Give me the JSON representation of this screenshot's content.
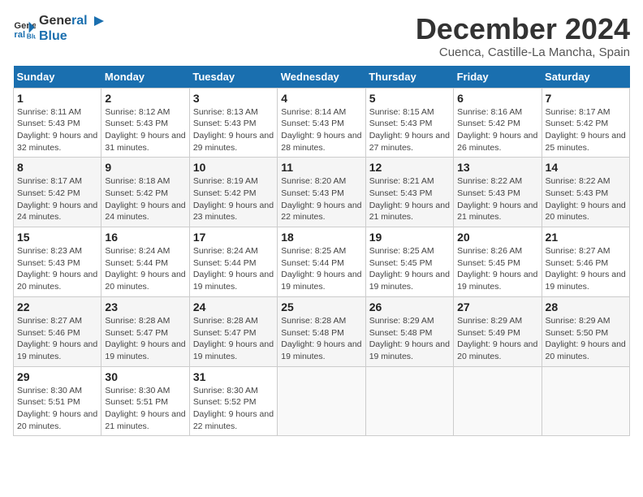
{
  "logo": {
    "general": "General",
    "blue": "Blue"
  },
  "title": "December 2024",
  "subtitle": "Cuenca, Castille-La Mancha, Spain",
  "days_of_week": [
    "Sunday",
    "Monday",
    "Tuesday",
    "Wednesday",
    "Thursday",
    "Friday",
    "Saturday"
  ],
  "weeks": [
    [
      {
        "day": "1",
        "detail": "Sunrise: 8:11 AM\nSunset: 5:43 PM\nDaylight: 9 hours and 32 minutes."
      },
      {
        "day": "2",
        "detail": "Sunrise: 8:12 AM\nSunset: 5:43 PM\nDaylight: 9 hours and 31 minutes."
      },
      {
        "day": "3",
        "detail": "Sunrise: 8:13 AM\nSunset: 5:43 PM\nDaylight: 9 hours and 29 minutes."
      },
      {
        "day": "4",
        "detail": "Sunrise: 8:14 AM\nSunset: 5:43 PM\nDaylight: 9 hours and 28 minutes."
      },
      {
        "day": "5",
        "detail": "Sunrise: 8:15 AM\nSunset: 5:43 PM\nDaylight: 9 hours and 27 minutes."
      },
      {
        "day": "6",
        "detail": "Sunrise: 8:16 AM\nSunset: 5:42 PM\nDaylight: 9 hours and 26 minutes."
      },
      {
        "day": "7",
        "detail": "Sunrise: 8:17 AM\nSunset: 5:42 PM\nDaylight: 9 hours and 25 minutes."
      }
    ],
    [
      {
        "day": "8",
        "detail": "Sunrise: 8:17 AM\nSunset: 5:42 PM\nDaylight: 9 hours and 24 minutes."
      },
      {
        "day": "9",
        "detail": "Sunrise: 8:18 AM\nSunset: 5:42 PM\nDaylight: 9 hours and 24 minutes."
      },
      {
        "day": "10",
        "detail": "Sunrise: 8:19 AM\nSunset: 5:42 PM\nDaylight: 9 hours and 23 minutes."
      },
      {
        "day": "11",
        "detail": "Sunrise: 8:20 AM\nSunset: 5:43 PM\nDaylight: 9 hours and 22 minutes."
      },
      {
        "day": "12",
        "detail": "Sunrise: 8:21 AM\nSunset: 5:43 PM\nDaylight: 9 hours and 21 minutes."
      },
      {
        "day": "13",
        "detail": "Sunrise: 8:22 AM\nSunset: 5:43 PM\nDaylight: 9 hours and 21 minutes."
      },
      {
        "day": "14",
        "detail": "Sunrise: 8:22 AM\nSunset: 5:43 PM\nDaylight: 9 hours and 20 minutes."
      }
    ],
    [
      {
        "day": "15",
        "detail": "Sunrise: 8:23 AM\nSunset: 5:43 PM\nDaylight: 9 hours and 20 minutes."
      },
      {
        "day": "16",
        "detail": "Sunrise: 8:24 AM\nSunset: 5:44 PM\nDaylight: 9 hours and 20 minutes."
      },
      {
        "day": "17",
        "detail": "Sunrise: 8:24 AM\nSunset: 5:44 PM\nDaylight: 9 hours and 19 minutes."
      },
      {
        "day": "18",
        "detail": "Sunrise: 8:25 AM\nSunset: 5:44 PM\nDaylight: 9 hours and 19 minutes."
      },
      {
        "day": "19",
        "detail": "Sunrise: 8:25 AM\nSunset: 5:45 PM\nDaylight: 9 hours and 19 minutes."
      },
      {
        "day": "20",
        "detail": "Sunrise: 8:26 AM\nSunset: 5:45 PM\nDaylight: 9 hours and 19 minutes."
      },
      {
        "day": "21",
        "detail": "Sunrise: 8:27 AM\nSunset: 5:46 PM\nDaylight: 9 hours and 19 minutes."
      }
    ],
    [
      {
        "day": "22",
        "detail": "Sunrise: 8:27 AM\nSunset: 5:46 PM\nDaylight: 9 hours and 19 minutes."
      },
      {
        "day": "23",
        "detail": "Sunrise: 8:28 AM\nSunset: 5:47 PM\nDaylight: 9 hours and 19 minutes."
      },
      {
        "day": "24",
        "detail": "Sunrise: 8:28 AM\nSunset: 5:47 PM\nDaylight: 9 hours and 19 minutes."
      },
      {
        "day": "25",
        "detail": "Sunrise: 8:28 AM\nSunset: 5:48 PM\nDaylight: 9 hours and 19 minutes."
      },
      {
        "day": "26",
        "detail": "Sunrise: 8:29 AM\nSunset: 5:48 PM\nDaylight: 9 hours and 19 minutes."
      },
      {
        "day": "27",
        "detail": "Sunrise: 8:29 AM\nSunset: 5:49 PM\nDaylight: 9 hours and 20 minutes."
      },
      {
        "day": "28",
        "detail": "Sunrise: 8:29 AM\nSunset: 5:50 PM\nDaylight: 9 hours and 20 minutes."
      }
    ],
    [
      {
        "day": "29",
        "detail": "Sunrise: 8:30 AM\nSunset: 5:51 PM\nDaylight: 9 hours and 20 minutes."
      },
      {
        "day": "30",
        "detail": "Sunrise: 8:30 AM\nSunset: 5:51 PM\nDaylight: 9 hours and 21 minutes."
      },
      {
        "day": "31",
        "detail": "Sunrise: 8:30 AM\nSunset: 5:52 PM\nDaylight: 9 hours and 22 minutes."
      },
      null,
      null,
      null,
      null
    ]
  ]
}
